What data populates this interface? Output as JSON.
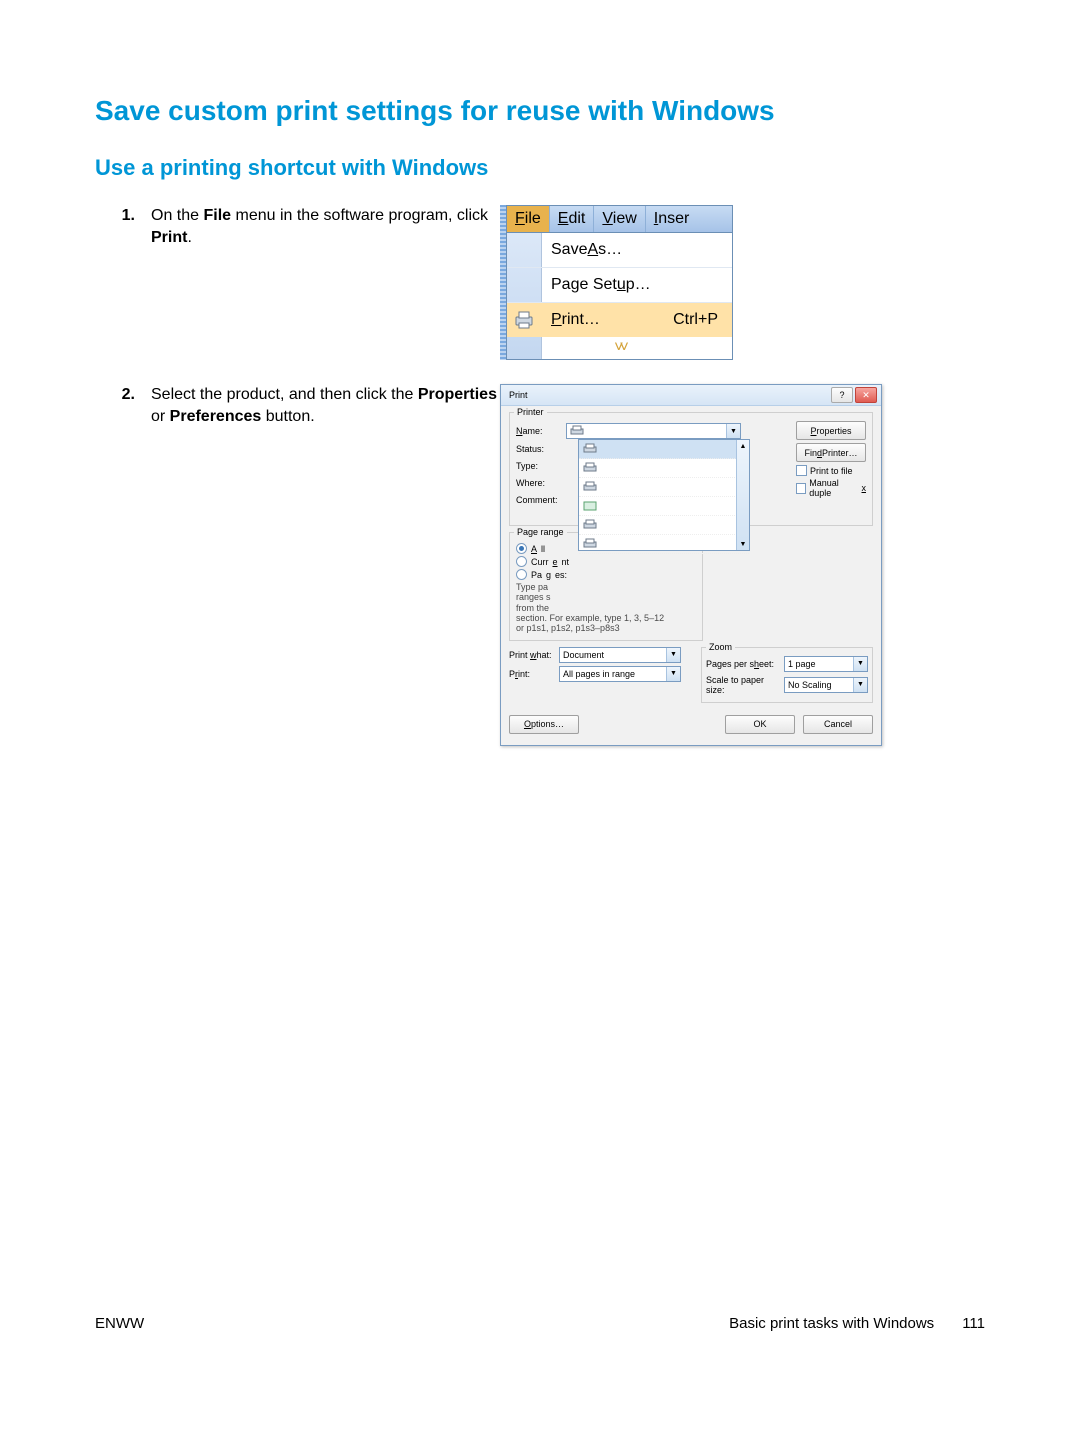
{
  "title": "Save custom print settings for reuse with Windows",
  "subtitle": "Use a printing shortcut with Windows",
  "steps": {
    "s1": {
      "num": "1.",
      "pre": "On the ",
      "b1": "File",
      "mid": " menu in the software program, click ",
      "b2": "Print",
      "post": "."
    },
    "s2": {
      "num": "2.",
      "pre": "Select the product, and then click the ",
      "b1": "Properties",
      "mid": " or ",
      "b2": "Preferences",
      "post": " button."
    }
  },
  "fig1": {
    "menubar": {
      "file_u": "F",
      "file_r": "ile",
      "edit_u": "E",
      "edit_r": "dit",
      "view_u": "V",
      "view_r": "iew",
      "inser_u": "I",
      "inser_r": "nser"
    },
    "items": {
      "saveas_pre": "Save ",
      "saveas_u": "A",
      "saveas_post": "s…",
      "pagesetup_pre": "Page Set",
      "pagesetup_u": "u",
      "pagesetup_post": "p…",
      "print_u": "P",
      "print_r": "rint…",
      "print_kbd": "Ctrl+P"
    }
  },
  "fig2": {
    "title": "Print",
    "buttons": {
      "properties_u": "P",
      "properties_r": "roperties",
      "findprinter_pre": "Fin",
      "findprinter_u": "d",
      "findprinter_post": " Printer…",
      "options_u": "O",
      "options_r": "ptions…",
      "ok": "OK",
      "cancel": "Cancel"
    },
    "printer_group": "Printer",
    "labels": {
      "name_u": "N",
      "name_r": "ame:",
      "status": "Status:",
      "type": "Type:",
      "where": "Where:",
      "comment": "Comment:"
    },
    "check": {
      "printtofile": "Print to file",
      "manualduplex_pre": "Manual duple",
      "manualduplex_u": "x"
    },
    "range_group": "Page range",
    "range": {
      "all_u": "A",
      "all_r": "ll",
      "current_pre": "Curr",
      "current_u": "e",
      "current_post": "nt",
      "pages_pre": "Pa",
      "pages_u": "g",
      "pages_post": "es:",
      "note1": "Type pa",
      "note2": "ranges s",
      "note3": "from the",
      "note4": "section. For example, type 1, 3, 5–12",
      "note5": "or p1s1, p1s2, p1s3–p8s3"
    },
    "printwhat_label_pre": "Print ",
    "printwhat_label_u": "w",
    "printwhat_label_post": "hat:",
    "printwhat_value": "Document",
    "print_label_pre": "P",
    "print_label_u": "r",
    "print_label_post": "int:",
    "print_value": "All pages in range",
    "zoom_group": "Zoom",
    "zoom": {
      "pps_label_pre": "Pages per s",
      "pps_label_u": "h",
      "pps_label_post": "eet:",
      "pps_value": "1 page",
      "sps_label": "Scale to paper size:",
      "sps_value": "No Scaling"
    }
  },
  "footer": {
    "left": "ENWW",
    "section": "Basic print tasks with Windows",
    "page": "111"
  }
}
